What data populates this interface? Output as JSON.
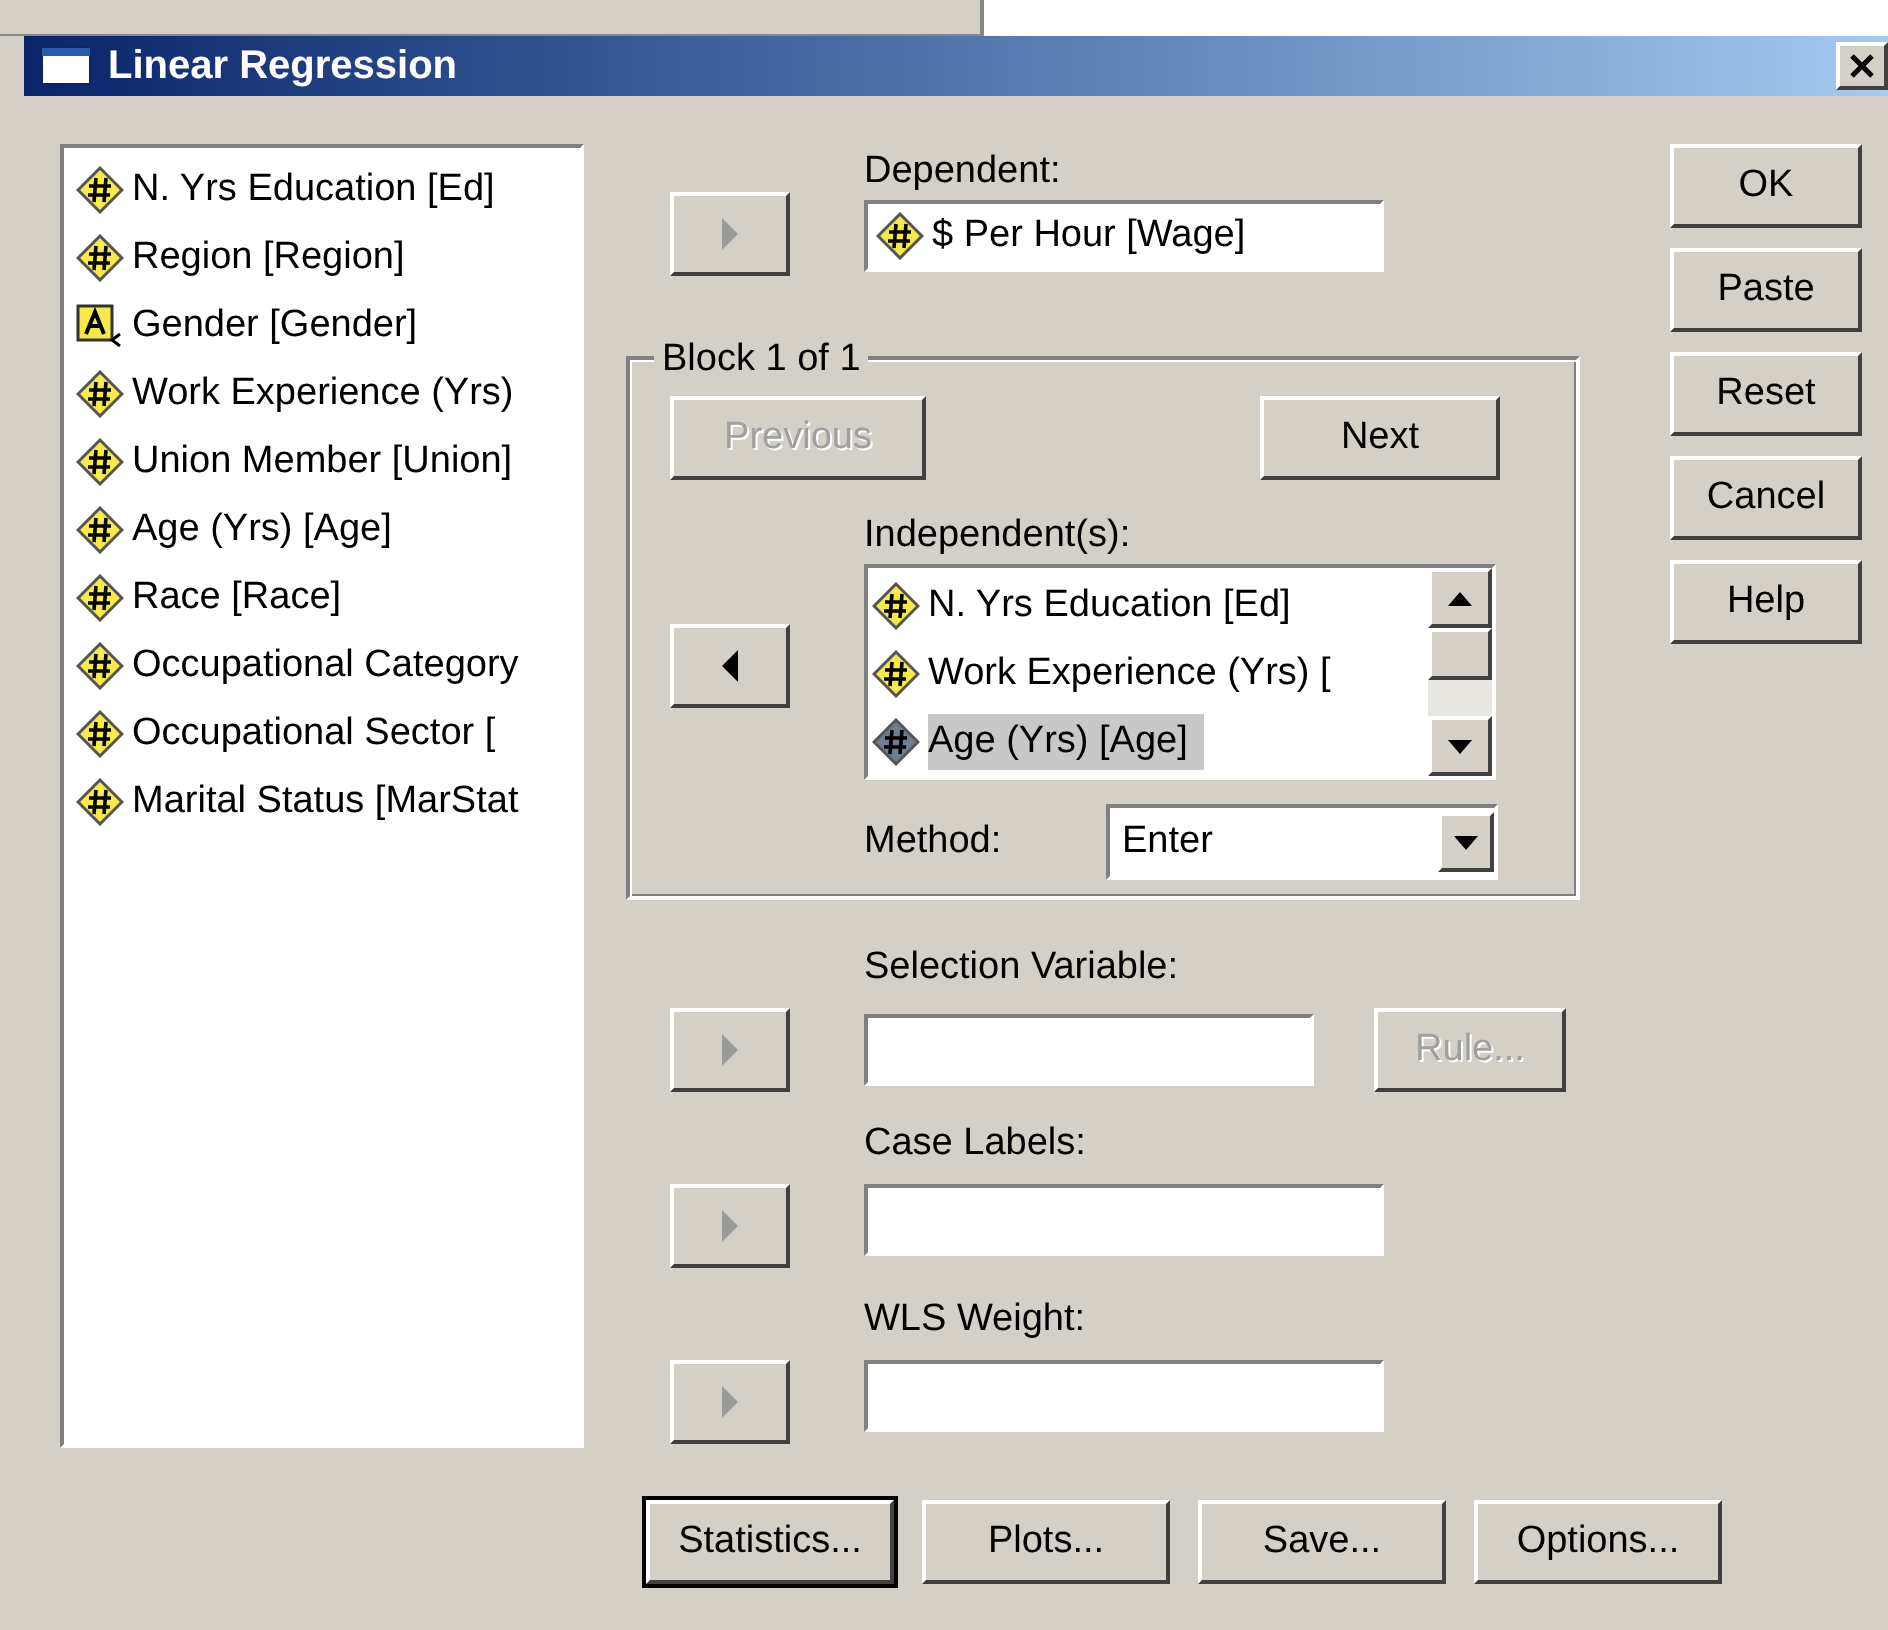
{
  "window": {
    "title": "Linear Regression"
  },
  "variables": [
    {
      "label": "N. Yrs Education [Ed]",
      "kind": "scale"
    },
    {
      "label": "Region [Region]",
      "kind": "scale"
    },
    {
      "label": "Gender [Gender]",
      "kind": "nominal"
    },
    {
      "label": "Work Experience (Yrs)",
      "kind": "scale"
    },
    {
      "label": "Union Member [Union]",
      "kind": "scale"
    },
    {
      "label": "Age (Yrs) [Age]",
      "kind": "scale"
    },
    {
      "label": "Race [Race]",
      "kind": "scale"
    },
    {
      "label": "Occupational Category",
      "kind": "scale"
    },
    {
      "label": "Occupational Sector [",
      "kind": "scale"
    },
    {
      "label": "Marital Status [MarStat",
      "kind": "scale"
    }
  ],
  "dependent": {
    "label": "Dependent:",
    "arrow": {
      "kind": "right",
      "disabled": true
    },
    "value": {
      "label": "$ Per Hour [Wage]",
      "kind": "scale"
    }
  },
  "block": {
    "title": "Block 1 of 1",
    "previous": {
      "label": "Previous",
      "disabled": true
    },
    "next": {
      "label": "Next",
      "disabled": false
    },
    "arrow": {
      "kind": "left",
      "disabled": false
    },
    "independents_label": "Independent(s):",
    "independents": [
      {
        "label": "N. Yrs Education [Ed]",
        "kind": "scale",
        "selected": false
      },
      {
        "label": "Work Experience (Yrs) [",
        "kind": "scale",
        "selected": false
      },
      {
        "label": "Age (Yrs) [Age]",
        "kind": "scale",
        "selected": true
      }
    ],
    "method_label": "Method:",
    "method": "Enter"
  },
  "selection_variable": {
    "label": "Selection Variable:",
    "arrow": {
      "kind": "right",
      "disabled": true
    },
    "rule": {
      "label": "Rule...",
      "disabled": true
    }
  },
  "case_labels": {
    "label": "Case Labels:",
    "arrow": {
      "kind": "right",
      "disabled": true
    }
  },
  "wls_weight": {
    "label": "WLS Weight:",
    "arrow": {
      "kind": "right",
      "disabled": true
    }
  },
  "side_buttons": [
    "OK",
    "Paste",
    "Reset",
    "Cancel",
    "Help"
  ],
  "bottom_buttons": [
    {
      "label": "Statistics...",
      "focused": true
    },
    {
      "label": "Plots...",
      "focused": false
    },
    {
      "label": "Save...",
      "focused": false
    },
    {
      "label": "Options...",
      "focused": false
    }
  ]
}
